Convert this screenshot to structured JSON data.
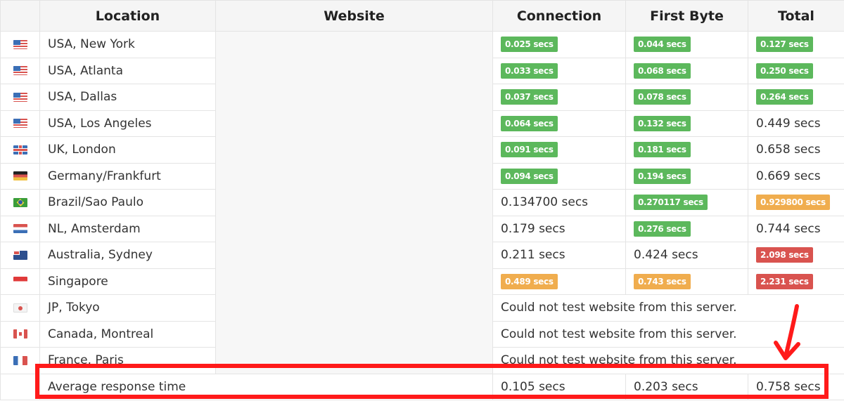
{
  "table": {
    "headers": {
      "flag": "",
      "location": "Location",
      "website": "Website",
      "connection": "Connection",
      "first_byte": "First Byte",
      "total": "Total"
    },
    "unit": "secs",
    "rows": [
      {
        "flag": "us-flag-icon",
        "location": "USA, New York",
        "connection": {
          "text": "0.025 secs",
          "status": "green"
        },
        "first_byte": {
          "text": "0.044 secs",
          "status": "green"
        },
        "total": {
          "text": "0.127 secs",
          "status": "green"
        }
      },
      {
        "flag": "us-flag-icon",
        "location": "USA, Atlanta",
        "connection": {
          "text": "0.033 secs",
          "status": "green"
        },
        "first_byte": {
          "text": "0.068 secs",
          "status": "green"
        },
        "total": {
          "text": "0.250 secs",
          "status": "green"
        }
      },
      {
        "flag": "us-flag-icon",
        "location": "USA, Dallas",
        "connection": {
          "text": "0.037 secs",
          "status": "green"
        },
        "first_byte": {
          "text": "0.078 secs",
          "status": "green"
        },
        "total": {
          "text": "0.264 secs",
          "status": "green"
        }
      },
      {
        "flag": "us-flag-icon",
        "location": "USA, Los Angeles",
        "connection": {
          "text": "0.064 secs",
          "status": "green"
        },
        "first_byte": {
          "text": "0.132 secs",
          "status": "green"
        },
        "total": {
          "text": "0.449 secs",
          "status": "plain"
        }
      },
      {
        "flag": "uk-flag-icon",
        "location": "UK, London",
        "connection": {
          "text": "0.091 secs",
          "status": "green"
        },
        "first_byte": {
          "text": "0.181 secs",
          "status": "green"
        },
        "total": {
          "text": "0.658 secs",
          "status": "plain"
        }
      },
      {
        "flag": "de-flag-icon",
        "location": "Germany/Frankfurt",
        "connection": {
          "text": "0.094 secs",
          "status": "green"
        },
        "first_byte": {
          "text": "0.194 secs",
          "status": "green"
        },
        "total": {
          "text": "0.669 secs",
          "status": "plain"
        }
      },
      {
        "flag": "br-flag-icon",
        "location": "Brazil/Sao Paulo",
        "connection": {
          "text": "0.134700 secs",
          "status": "plain"
        },
        "first_byte": {
          "text": "0.270117 secs",
          "status": "green"
        },
        "total": {
          "text": "0.929800 secs",
          "status": "orange"
        }
      },
      {
        "flag": "nl-flag-icon",
        "location": "NL, Amsterdam",
        "connection": {
          "text": "0.179 secs",
          "status": "plain"
        },
        "first_byte": {
          "text": "0.276 secs",
          "status": "green"
        },
        "total": {
          "text": "0.744 secs",
          "status": "plain"
        }
      },
      {
        "flag": "au-flag-icon",
        "location": "Australia, Sydney",
        "connection": {
          "text": "0.211 secs",
          "status": "plain"
        },
        "first_byte": {
          "text": "0.424 secs",
          "status": "plain"
        },
        "total": {
          "text": "2.098 secs",
          "status": "red"
        }
      },
      {
        "flag": "sg-flag-icon",
        "location": "Singapore",
        "connection": {
          "text": "0.489 secs",
          "status": "orange"
        },
        "first_byte": {
          "text": "0.743 secs",
          "status": "orange"
        },
        "total": {
          "text": "2.231 secs",
          "status": "red"
        }
      },
      {
        "flag": "jp-flag-icon",
        "location": "JP, Tokyo",
        "error": "Could not test website from this server."
      },
      {
        "flag": "ca-flag-icon",
        "location": "Canada, Montreal",
        "error": "Could not test website from this server."
      },
      {
        "flag": "fr-flag-icon",
        "location": "France, Paris",
        "error": "Could not test website from this server."
      }
    ],
    "average": {
      "label": "Average response time",
      "connection": "0.105 secs",
      "first_byte": "0.203 secs",
      "total": "0.758 secs"
    }
  },
  "annotations": {
    "highlight_color": "#ff1a1a",
    "arrow_color": "#ff1a1a"
  },
  "colors": {
    "green": "#5cb85c",
    "orange": "#f0ad4e",
    "red": "#d9534f"
  }
}
